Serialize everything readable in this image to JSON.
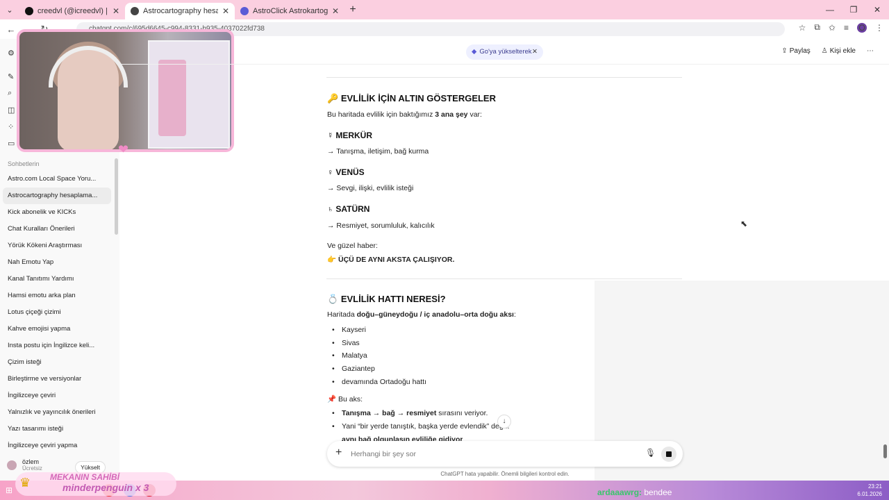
{
  "browser": {
    "tabs": [
      {
        "title": "creedvl (@icreedvl) | TikTok",
        "active": false,
        "favicon_color": "#111111"
      },
      {
        "title": "Astrocartography hesaplama ya",
        "active": true,
        "favicon_color": "#444444"
      },
      {
        "title": "AstroClick Astrokartografi Yoru",
        "active": false,
        "favicon_color": "#5b5bd6"
      }
    ],
    "url": "chatgpt.com/c/695d6645-c994-8331-b935-4037022fd738",
    "profile_initial": "O"
  },
  "sidebar": {
    "section_title": "Sohbetlerin",
    "items": [
      {
        "label": "Astro.com Local Space Yoru...",
        "active": false
      },
      {
        "label": "Astrocartography hesaplama...",
        "active": true
      },
      {
        "label": "Kick abonelik ve KICKs",
        "active": false
      },
      {
        "label": "Chat Kuralları Önerileri",
        "active": false
      },
      {
        "label": "Yörük Kökeni Araştırması",
        "active": false
      },
      {
        "label": "Nah Emotu Yap",
        "active": false
      },
      {
        "label": "Kanal Tanıtımı Yardımı",
        "active": false
      },
      {
        "label": "Hamsi emotu arka plan",
        "active": false
      },
      {
        "label": "Lotus çiçeği çizimi",
        "active": false
      },
      {
        "label": "Kahve emojisi yapma",
        "active": false
      },
      {
        "label": "Insta postu için İngilizce keli...",
        "active": false
      },
      {
        "label": "Çizim isteği",
        "active": false
      },
      {
        "label": "Birleştirme ve versiyonlar",
        "active": false
      },
      {
        "label": "İngilizceye çeviri",
        "active": false
      },
      {
        "label": "Yalnızlık ve yayıncılık önerileri",
        "active": false
      },
      {
        "label": "Yazı tasarımı isteği",
        "active": false
      },
      {
        "label": "İngilizceye çeviri yapma",
        "active": false
      }
    ],
    "user": {
      "name": "özlem",
      "plan": "Ücretsiz"
    },
    "upgrade_label": "Yükselt"
  },
  "header": {
    "pill_label": "Go'ya yükselterek",
    "share_label": "Paylaş",
    "add_people_label": "Kişi ekle"
  },
  "main": {
    "section1": {
      "icon": "🔑",
      "title": "EVLİLİK İÇİN ALTIN GÖSTERGELER",
      "intro_pre": "Bu haritada evlilik için baktığımız ",
      "intro_bold": "3 ana şey",
      "intro_post": " var:",
      "planets": [
        {
          "symbol": "☿",
          "name": "MERKÜR",
          "desc": "→ Tanışma, iletişim, bağ kurma"
        },
        {
          "symbol": "♀",
          "name": "VENÜS",
          "desc": "→ Sevgi, ilişki, evlilik isteği"
        },
        {
          "symbol": "♄",
          "name": "SATÜRN",
          "desc": "→ Resmiyet, sorumluluk, kalıcılık"
        }
      ],
      "good_news": "Ve güzel haber:",
      "good_news_icon": "👉",
      "good_news_bold": "ÜÇÜ DE AYNI AKSTA ÇALIŞIYOR."
    },
    "section2": {
      "icon": "💍",
      "title": "EVLİLİK HATTI NERESİ?",
      "intro_pre": "Haritada ",
      "intro_bold": "doğu–güneydoğu / iç anadolu–orta doğu aksı",
      "intro_post": ":",
      "cities": [
        "Kayseri",
        "Sivas",
        "Malatya",
        "Gaziantep",
        "devamında Ortadoğu hattı"
      ],
      "axis_icon": "📌",
      "axis_label": "Bu aks:",
      "axis_bullets": [
        {
          "bold": "Tanışma → bağ → resmiyet",
          "rest": " sırasını veriyor."
        },
        {
          "bold": "",
          "rest": "Yani “bir yerde tanıştık, başka yerde evlendik” değ..."
        },
        {
          "bold": "aynı bağ olgunlaşın evliliğe gidiyor",
          "rest": ""
        }
      ]
    }
  },
  "composer": {
    "placeholder": "Herhangi bir şey sor",
    "disclaimer": "ChatGPT hata yapabilir. Önemli bilgileri kontrol edin."
  },
  "stream_overlay": {
    "alert_line1": "MEKANIN SAHİBİ",
    "alert_line2": "minderpenguin x 3",
    "chat_user": "ardaaawrg:",
    "chat_text": "bendee"
  },
  "taskbar": {
    "time": "23:21",
    "date": "6.01.2026"
  }
}
